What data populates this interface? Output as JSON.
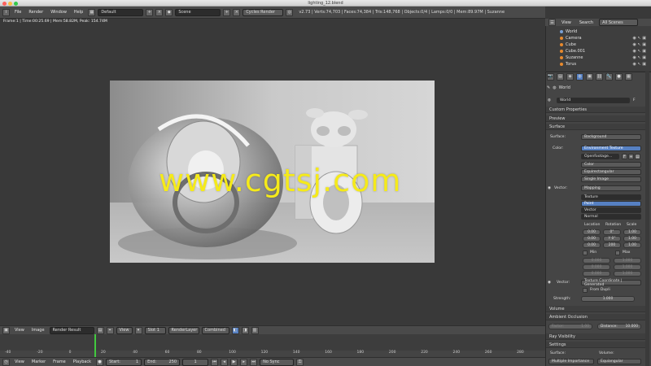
{
  "window": {
    "title": "lighting_12.blend"
  },
  "menu": [
    "File",
    "Render",
    "Window",
    "Help"
  ],
  "layout": "Default",
  "scene": "Scene",
  "engine": "Cycles Render",
  "stats": "v2.73 | Verts:74,703 | Faces:74,384 | Tris:148,768 | Objects:0/4 | Lamps:0/0 | Mem:89.97M | Suzanne",
  "frame_info": "Frame:1 | Time:00:25.69 | Mem:58.82M, Peak: 154.74M",
  "watermark": "www.cgtsj.com",
  "image_editor": {
    "view": "View",
    "image": "Image",
    "render_result": "Render Result",
    "view2": "View",
    "slot": "Slot 1",
    "layer": "RenderLayer",
    "pass": "Combined"
  },
  "timeline": {
    "ticks": [
      "-40",
      "-20",
      "0",
      "20",
      "40",
      "60",
      "80",
      "100",
      "120",
      "140",
      "160",
      "180",
      "200",
      "220",
      "240",
      "260",
      "280"
    ],
    "menu": [
      "View",
      "Marker",
      "Frame",
      "Playback"
    ],
    "start_label": "Start:",
    "start": "1",
    "end_label": "End:",
    "end": "250",
    "current": "1",
    "sync": "No Sync"
  },
  "outliner": {
    "header": [
      "View",
      "Search"
    ],
    "filter": "All Scenes",
    "items": [
      "World",
      "Camera",
      "Cube",
      "Cube.001",
      "Suzanne",
      "Torus"
    ]
  },
  "properties": {
    "context": "World",
    "world_name": "World",
    "panels": [
      "Custom Properties",
      "Preview",
      "Surface"
    ],
    "surface_label": "Surface:",
    "surface": "Background",
    "color_label": "Color:",
    "color_node": "Environment Texture",
    "image": "Openfootage...",
    "color_space": "Color",
    "projection": "Equirectangular",
    "source": "Single Image",
    "vector_label": "Vector:",
    "mapping": "Mapping",
    "vector_types": [
      "Texture",
      "Point",
      "Vector",
      "Normal"
    ],
    "selected_type": "Point",
    "loc_label": "Location",
    "rot_label": "Rotation",
    "scale_label": "Scale",
    "loc": [
      "0.00",
      "0.00",
      "0.00"
    ],
    "rot": [
      "0°",
      "Y 0°",
      "200"
    ],
    "scale": [
      "1.00",
      "1.00",
      "1.00"
    ],
    "min": "Min",
    "max": "Max",
    "min_vals": [
      "0.000",
      "0.000",
      "0.000"
    ],
    "max_vals": [
      "1.000",
      "1.000",
      "1.000"
    ],
    "vector2_label": "Vector:",
    "tex_coord": "Texture Coordinate | Generated",
    "from_dupli": "From Dupli",
    "strength_label": "Strength:",
    "strength": "1.000",
    "volume": "Volume",
    "ao": "Ambient Occlusion",
    "factor_label": "Factor:",
    "factor": "1.00",
    "distance_label": "Distance:",
    "distance": "10.000",
    "ray_visibility": "Ray Visibility",
    "settings": "Settings",
    "surface2": "Surface:",
    "volume2": "Volume:",
    "mis": "Multiple Importance",
    "volume_val": "Equiangular"
  }
}
